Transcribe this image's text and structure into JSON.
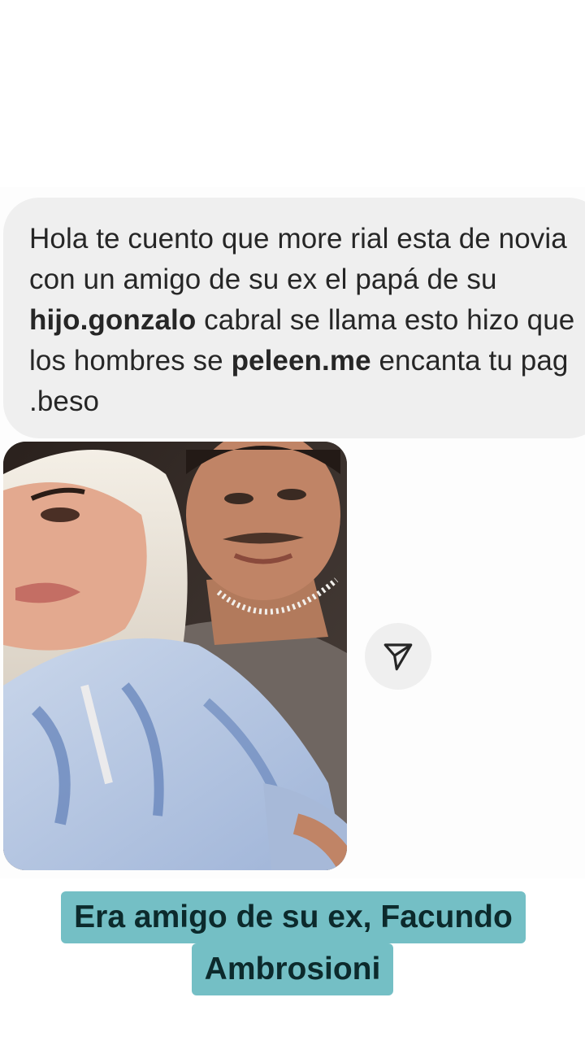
{
  "message": {
    "part1": "Hola te cuento que more rial esta de novia con un amigo de su ex el papá de su ",
    "bold1": "hijo.gonzalo",
    "part2": " cabral se llama esto hizo que los hombres se ",
    "bold2": "peleen.me",
    "part3": " encanta tu pag .beso"
  },
  "photo": {
    "icon": "shared-photo"
  },
  "share_button": {
    "icon": "send-icon"
  },
  "caption": {
    "line1": "Era amigo de su ex, Facundo",
    "line2": "Ambrosioni"
  },
  "colors": {
    "bubble": "#efefef",
    "caption_bg": "#74bfc5",
    "caption_text": "#0c2a2c",
    "text": "#262626"
  }
}
